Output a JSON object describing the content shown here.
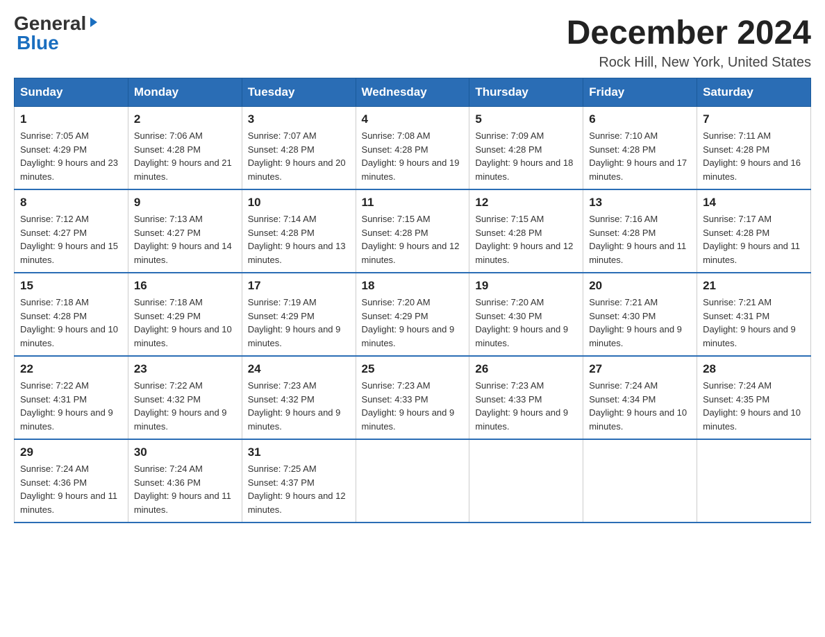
{
  "header": {
    "logo_general": "General",
    "logo_blue": "Blue",
    "month_year": "December 2024",
    "location": "Rock Hill, New York, United States"
  },
  "weekdays": [
    "Sunday",
    "Monday",
    "Tuesday",
    "Wednesday",
    "Thursday",
    "Friday",
    "Saturday"
  ],
  "weeks": [
    [
      {
        "day": "1",
        "sunrise": "7:05 AM",
        "sunset": "4:29 PM",
        "daylight": "9 hours and 23 minutes."
      },
      {
        "day": "2",
        "sunrise": "7:06 AM",
        "sunset": "4:28 PM",
        "daylight": "9 hours and 21 minutes."
      },
      {
        "day": "3",
        "sunrise": "7:07 AM",
        "sunset": "4:28 PM",
        "daylight": "9 hours and 20 minutes."
      },
      {
        "day": "4",
        "sunrise": "7:08 AM",
        "sunset": "4:28 PM",
        "daylight": "9 hours and 19 minutes."
      },
      {
        "day": "5",
        "sunrise": "7:09 AM",
        "sunset": "4:28 PM",
        "daylight": "9 hours and 18 minutes."
      },
      {
        "day": "6",
        "sunrise": "7:10 AM",
        "sunset": "4:28 PM",
        "daylight": "9 hours and 17 minutes."
      },
      {
        "day": "7",
        "sunrise": "7:11 AM",
        "sunset": "4:28 PM",
        "daylight": "9 hours and 16 minutes."
      }
    ],
    [
      {
        "day": "8",
        "sunrise": "7:12 AM",
        "sunset": "4:27 PM",
        "daylight": "9 hours and 15 minutes."
      },
      {
        "day": "9",
        "sunrise": "7:13 AM",
        "sunset": "4:27 PM",
        "daylight": "9 hours and 14 minutes."
      },
      {
        "day": "10",
        "sunrise": "7:14 AM",
        "sunset": "4:28 PM",
        "daylight": "9 hours and 13 minutes."
      },
      {
        "day": "11",
        "sunrise": "7:15 AM",
        "sunset": "4:28 PM",
        "daylight": "9 hours and 12 minutes."
      },
      {
        "day": "12",
        "sunrise": "7:15 AM",
        "sunset": "4:28 PM",
        "daylight": "9 hours and 12 minutes."
      },
      {
        "day": "13",
        "sunrise": "7:16 AM",
        "sunset": "4:28 PM",
        "daylight": "9 hours and 11 minutes."
      },
      {
        "day": "14",
        "sunrise": "7:17 AM",
        "sunset": "4:28 PM",
        "daylight": "9 hours and 11 minutes."
      }
    ],
    [
      {
        "day": "15",
        "sunrise": "7:18 AM",
        "sunset": "4:28 PM",
        "daylight": "9 hours and 10 minutes."
      },
      {
        "day": "16",
        "sunrise": "7:18 AM",
        "sunset": "4:29 PM",
        "daylight": "9 hours and 10 minutes."
      },
      {
        "day": "17",
        "sunrise": "7:19 AM",
        "sunset": "4:29 PM",
        "daylight": "9 hours and 9 minutes."
      },
      {
        "day": "18",
        "sunrise": "7:20 AM",
        "sunset": "4:29 PM",
        "daylight": "9 hours and 9 minutes."
      },
      {
        "day": "19",
        "sunrise": "7:20 AM",
        "sunset": "4:30 PM",
        "daylight": "9 hours and 9 minutes."
      },
      {
        "day": "20",
        "sunrise": "7:21 AM",
        "sunset": "4:30 PM",
        "daylight": "9 hours and 9 minutes."
      },
      {
        "day": "21",
        "sunrise": "7:21 AM",
        "sunset": "4:31 PM",
        "daylight": "9 hours and 9 minutes."
      }
    ],
    [
      {
        "day": "22",
        "sunrise": "7:22 AM",
        "sunset": "4:31 PM",
        "daylight": "9 hours and 9 minutes."
      },
      {
        "day": "23",
        "sunrise": "7:22 AM",
        "sunset": "4:32 PM",
        "daylight": "9 hours and 9 minutes."
      },
      {
        "day": "24",
        "sunrise": "7:23 AM",
        "sunset": "4:32 PM",
        "daylight": "9 hours and 9 minutes."
      },
      {
        "day": "25",
        "sunrise": "7:23 AM",
        "sunset": "4:33 PM",
        "daylight": "9 hours and 9 minutes."
      },
      {
        "day": "26",
        "sunrise": "7:23 AM",
        "sunset": "4:33 PM",
        "daylight": "9 hours and 9 minutes."
      },
      {
        "day": "27",
        "sunrise": "7:24 AM",
        "sunset": "4:34 PM",
        "daylight": "9 hours and 10 minutes."
      },
      {
        "day": "28",
        "sunrise": "7:24 AM",
        "sunset": "4:35 PM",
        "daylight": "9 hours and 10 minutes."
      }
    ],
    [
      {
        "day": "29",
        "sunrise": "7:24 AM",
        "sunset": "4:36 PM",
        "daylight": "9 hours and 11 minutes."
      },
      {
        "day": "30",
        "sunrise": "7:24 AM",
        "sunset": "4:36 PM",
        "daylight": "9 hours and 11 minutes."
      },
      {
        "day": "31",
        "sunrise": "7:25 AM",
        "sunset": "4:37 PM",
        "daylight": "9 hours and 12 minutes."
      },
      null,
      null,
      null,
      null
    ]
  ]
}
